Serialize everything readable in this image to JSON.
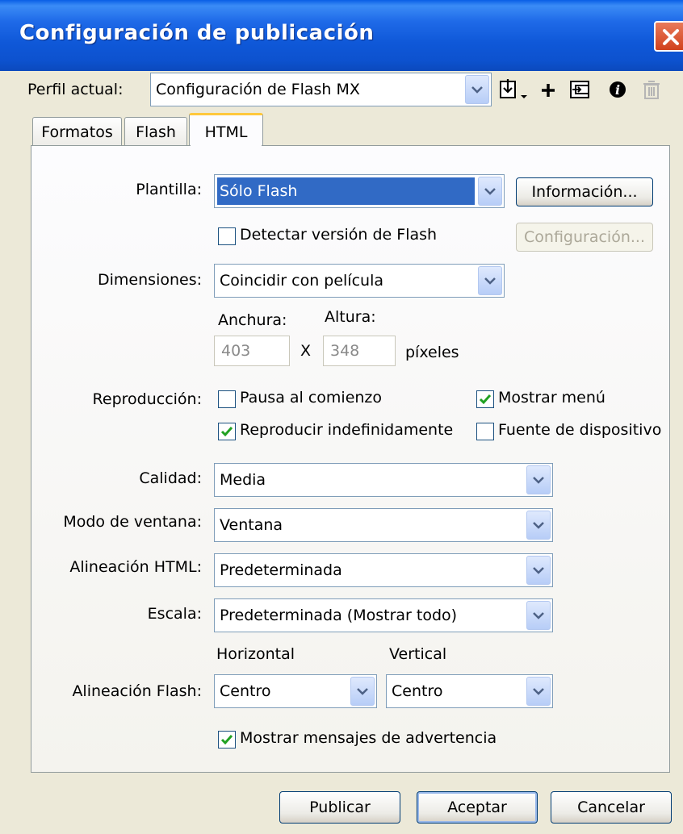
{
  "window": {
    "title": "Configuración de publicación"
  },
  "profile": {
    "label": "Perfil actual:",
    "value": "Configuración de Flash MX"
  },
  "toolbar_icons": [
    "import-export-icon",
    "add-icon",
    "duplicate-icon",
    "info-icon",
    "trash-icon"
  ],
  "tabs": [
    {
      "label": "Formatos"
    },
    {
      "label": "Flash"
    },
    {
      "label": "HTML",
      "active": true
    }
  ],
  "template": {
    "label": "Plantilla:",
    "value": "Sólo Flash",
    "info_button": "Información..."
  },
  "detect_version": {
    "label": "Detectar versión de Flash",
    "checked": false,
    "config_button": "Configuración..."
  },
  "dimensions": {
    "label": "Dimensiones:",
    "value": "Coincidir con película",
    "width_label": "Anchura:",
    "height_label": "Altura:",
    "width": "403",
    "height": "348",
    "separator": "X",
    "units": "píxeles"
  },
  "playback": {
    "label": "Reproducción:",
    "pause": {
      "label": "Pausa al comienzo",
      "checked": false
    },
    "loop": {
      "label": "Reproducir indefinidamente",
      "checked": true
    },
    "menu": {
      "label": "Mostrar menú",
      "checked": true
    },
    "device_font": {
      "label": "Fuente de dispositivo",
      "checked": false
    }
  },
  "quality": {
    "label": "Calidad:",
    "value": "Media"
  },
  "window_mode": {
    "label": "Modo de ventana:",
    "value": "Ventana"
  },
  "html_align": {
    "label": "Alineación HTML:",
    "value": "Predeterminada"
  },
  "scale": {
    "label": "Escala:",
    "value": "Predeterminada (Mostrar todo)"
  },
  "flash_align": {
    "label": "Alineación Flash:",
    "horizontal_label": "Horizontal",
    "vertical_label": "Vertical",
    "horizontal": "Centro",
    "vertical": "Centro"
  },
  "warnings": {
    "label": "Mostrar mensajes de advertencia",
    "checked": true
  },
  "buttons": {
    "publish": "Publicar",
    "ok": "Aceptar",
    "cancel": "Cancelar"
  },
  "colors": {
    "titlebar": "#0b53d7",
    "selection": "#316ac5",
    "tab_highlight": "#ffc83c",
    "check": "#21a121"
  }
}
